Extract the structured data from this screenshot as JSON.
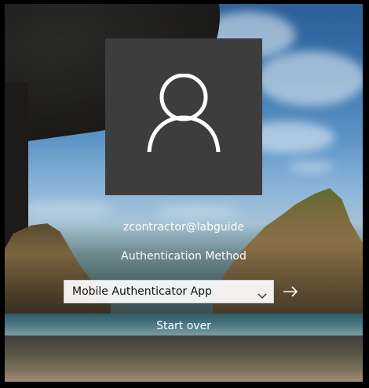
{
  "user": {
    "username": "zcontractor@labguide"
  },
  "auth": {
    "label": "Authentication Method",
    "selected_method": "Mobile Authenticator App",
    "start_over": "Start over"
  },
  "icons": {
    "avatar": "user-icon",
    "dropdown": "chevron-down-icon",
    "submit": "arrow-right-icon"
  },
  "colors": {
    "tile": "#3d3d3d",
    "text": "#ffffff"
  }
}
